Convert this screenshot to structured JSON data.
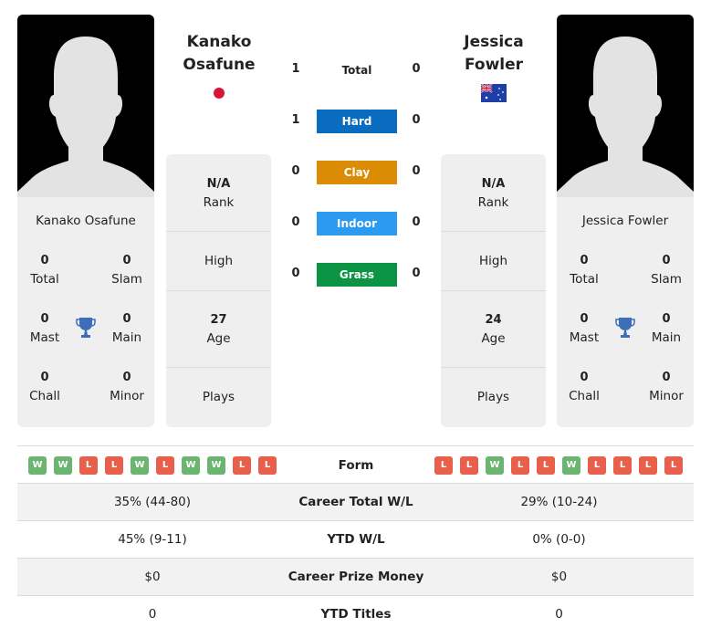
{
  "player_left": {
    "name": "Kanako Osafune",
    "name_line1": "Kanako",
    "name_line2": "Osafune",
    "flag": "japan-flag-icon",
    "titles": {
      "total": {
        "value": "0",
        "label": "Total"
      },
      "slam": {
        "value": "0",
        "label": "Slam"
      },
      "mast": {
        "value": "0",
        "label": "Mast"
      },
      "main": {
        "value": "0",
        "label": "Main"
      },
      "chall": {
        "value": "0",
        "label": "Chall"
      },
      "minor": {
        "value": "0",
        "label": "Minor"
      }
    },
    "info": {
      "rank": {
        "value": "N/A",
        "label": "Rank"
      },
      "high": {
        "value": "",
        "label": "High"
      },
      "age": {
        "value": "27",
        "label": "Age"
      },
      "plays": {
        "value": "",
        "label": "Plays"
      }
    },
    "form": [
      "W",
      "W",
      "L",
      "L",
      "W",
      "L",
      "W",
      "W",
      "L",
      "L"
    ]
  },
  "player_right": {
    "name": "Jessica Fowler",
    "name_line1": "Jessica",
    "name_line2": "Fowler",
    "flag": "australia-flag-icon",
    "titles": {
      "total": {
        "value": "0",
        "label": "Total"
      },
      "slam": {
        "value": "0",
        "label": "Slam"
      },
      "mast": {
        "value": "0",
        "label": "Mast"
      },
      "main": {
        "value": "0",
        "label": "Main"
      },
      "chall": {
        "value": "0",
        "label": "Chall"
      },
      "minor": {
        "value": "0",
        "label": "Minor"
      }
    },
    "info": {
      "rank": {
        "value": "N/A",
        "label": "Rank"
      },
      "high": {
        "value": "",
        "label": "High"
      },
      "age": {
        "value": "24",
        "label": "Age"
      },
      "plays": {
        "value": "",
        "label": "Plays"
      }
    },
    "form": [
      "L",
      "L",
      "W",
      "L",
      "L",
      "W",
      "L",
      "L",
      "L",
      "L"
    ]
  },
  "h2h": [
    {
      "surface": "Total",
      "left": "1",
      "right": "0",
      "color": ""
    },
    {
      "surface": "Hard",
      "left": "1",
      "right": "0",
      "color": "#0a6cbf"
    },
    {
      "surface": "Clay",
      "left": "0",
      "right": "0",
      "color": "#dc8b04"
    },
    {
      "surface": "Indoor",
      "left": "0",
      "right": "0",
      "color": "#2c9bef"
    },
    {
      "surface": "Grass",
      "left": "0",
      "right": "0",
      "color": "#0a9443"
    }
  ],
  "comparison": {
    "form_label": "Form",
    "rows": [
      {
        "label": "Career Total W/L",
        "left": "35% (44-80)",
        "right": "29% (10-24)"
      },
      {
        "label": "YTD W/L",
        "left": "45% (9-11)",
        "right": "0% (0-0)"
      },
      {
        "label": "Career Prize Money",
        "left": "$0",
        "right": "$0"
      },
      {
        "label": "YTD Titles",
        "left": "0",
        "right": "0"
      }
    ]
  }
}
